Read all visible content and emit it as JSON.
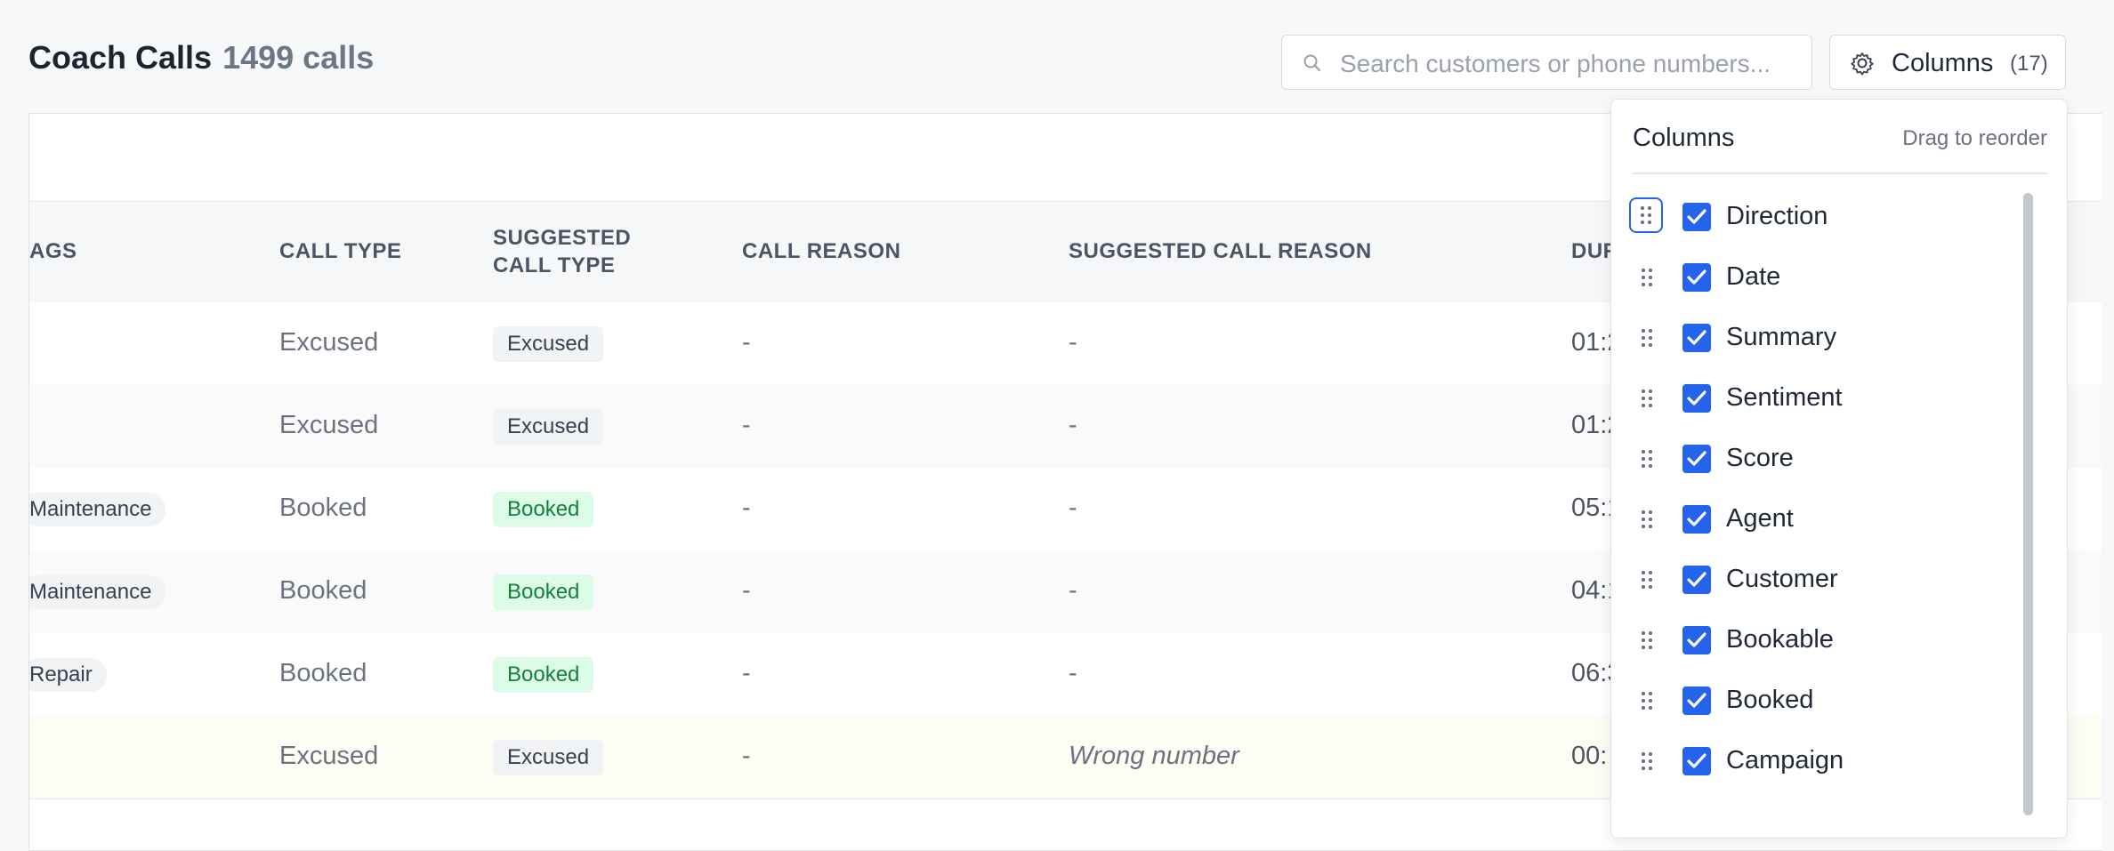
{
  "header": {
    "title": "Coach Calls",
    "count": "1499 calls",
    "search_placeholder": "Search customers or phone numbers...",
    "columns_button_label": "Columns",
    "columns_button_count": "(17)"
  },
  "table": {
    "headers": {
      "tags": "AGS",
      "call_type": "CALL TYPE",
      "suggested_call_type_line1": "SUGGESTED",
      "suggested_call_type_line2": "CALL TYPE",
      "call_reason": "CALL REASON",
      "suggested_call_reason": "SUGGESTED CALL REASON",
      "duration": "DUR"
    },
    "rows": [
      {
        "tag": "",
        "call_type": "Excused",
        "suggested": "Excused",
        "call_reason": "-",
        "suggested_reason": "-",
        "duration": "01:2"
      },
      {
        "tag": "",
        "call_type": "Excused",
        "suggested": "Excused",
        "call_reason": "-",
        "suggested_reason": "-",
        "duration": "01:2"
      },
      {
        "tag": "Maintenance",
        "call_type": "Booked",
        "suggested": "Booked",
        "call_reason": "-",
        "suggested_reason": "-",
        "duration": "05:1"
      },
      {
        "tag": "Maintenance",
        "call_type": "Booked",
        "suggested": "Booked",
        "call_reason": "-",
        "suggested_reason": "-",
        "duration": "04:1"
      },
      {
        "tag": "Repair",
        "call_type": "Booked",
        "suggested": "Booked",
        "call_reason": "-",
        "suggested_reason": "-",
        "duration": "06:3"
      },
      {
        "tag": "",
        "call_type": "Excused",
        "suggested": "Excused",
        "call_reason": "-",
        "suggested_reason": "Wrong number",
        "duration": "00:"
      }
    ]
  },
  "columns_panel": {
    "title": "Columns",
    "hint": "Drag to reorder",
    "items": [
      {
        "label": "Direction",
        "checked": true
      },
      {
        "label": "Date",
        "checked": true
      },
      {
        "label": "Summary",
        "checked": true
      },
      {
        "label": "Sentiment",
        "checked": true
      },
      {
        "label": "Score",
        "checked": true
      },
      {
        "label": "Agent",
        "checked": true
      },
      {
        "label": "Customer",
        "checked": true
      },
      {
        "label": "Bookable",
        "checked": true
      },
      {
        "label": "Booked",
        "checked": true
      },
      {
        "label": "Campaign",
        "checked": true
      }
    ]
  },
  "colors": {
    "accent": "#2563eb",
    "booked_badge_bg": "#dcfce7",
    "booked_badge_text": "#15803d",
    "excused_badge_bg": "#f1f3f5"
  }
}
